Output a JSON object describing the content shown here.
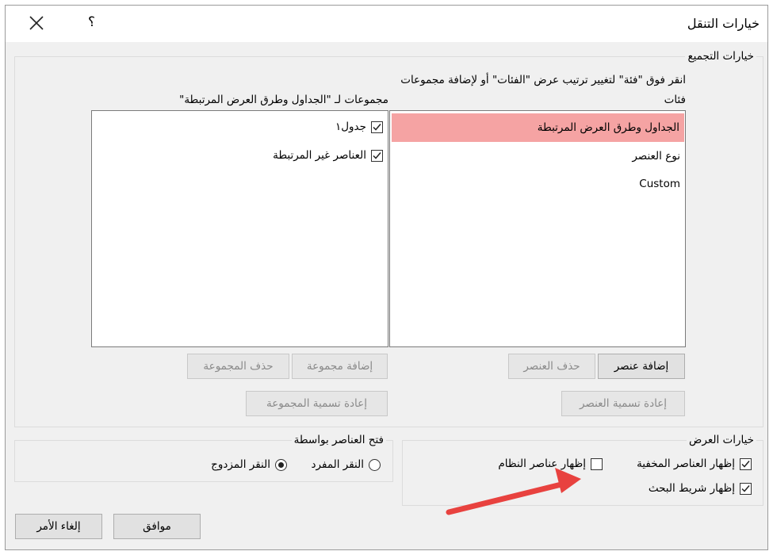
{
  "window": {
    "title": "خيارات التنقل",
    "help_label": "؟"
  },
  "grouping": {
    "legend": "خيارات التجميع",
    "instruction": "انقر فوق \"فئة\" لتغيير ترتيب عرض \"الفئات\" أو لإضافة مجموعات",
    "categories_label": "فئات",
    "groups_label": "مجموعات لـ \"الجداول وطرق العرض المرتبطة\"",
    "categories": [
      "الجداول وطرق العرض المرتبطة",
      "نوع العنصر",
      "Custom"
    ],
    "selected_category": 0,
    "groups": [
      {
        "label": "جدول١",
        "checked": true
      },
      {
        "label": "العناصر غير المرتبطة",
        "checked": true
      }
    ],
    "buttons": {
      "add_item": "إضافة عنصر",
      "delete_item": "حذف العنصر",
      "rename_item": "إعادة تسمية العنصر",
      "add_group": "إضافة مجموعة",
      "delete_group": "حذف المجموعة",
      "rename_group": "إعادة تسمية المجموعة"
    }
  },
  "display": {
    "legend": "خيارات العرض",
    "show_hidden": {
      "label": "إظهار العناصر المخفية",
      "checked": true
    },
    "show_system": {
      "label": "إظهار عناصر النظام",
      "checked": false
    },
    "show_search": {
      "label": "إظهار شريط البحث",
      "checked": true
    }
  },
  "open_with": {
    "legend": "فتح العناصر بواسطة",
    "single": {
      "label": "النقر المفرد",
      "selected": false
    },
    "double": {
      "label": "النقر المزدوج",
      "selected": true
    }
  },
  "footer": {
    "ok": "موافق",
    "cancel": "إلغاء الأمر"
  },
  "colors": {
    "selection": "#f5a3a3",
    "arrow": "#e8423f"
  }
}
